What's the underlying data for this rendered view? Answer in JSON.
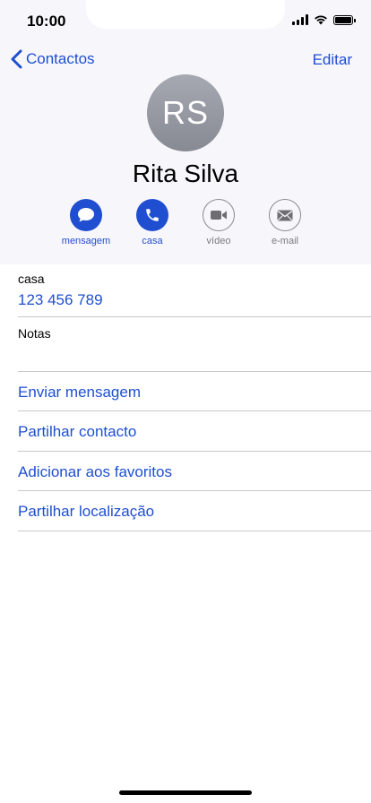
{
  "status_bar": {
    "time": "10:00"
  },
  "nav": {
    "back_label": "Contactos",
    "edit_label": "Editar"
  },
  "contact": {
    "initials": "RS",
    "name": "Rita Silva"
  },
  "actions": [
    {
      "label": "mensagem",
      "icon": "message-icon",
      "enabled": true
    },
    {
      "label": "casa",
      "icon": "phone-icon",
      "enabled": true
    },
    {
      "label": "vídeo",
      "icon": "video-icon",
      "enabled": false
    },
    {
      "label": "e-mail",
      "icon": "mail-icon",
      "enabled": false
    }
  ],
  "phone": {
    "label": "casa",
    "number": "123 456 789"
  },
  "notes": {
    "label": "Notas"
  },
  "links": [
    {
      "label": "Enviar mensagem"
    },
    {
      "label": "Partilhar contacto"
    },
    {
      "label": "Adicionar aos favoritos"
    },
    {
      "label": "Partilhar localização"
    }
  ],
  "colors": {
    "accent": "#1f4fd0",
    "header_background": "#f7f6fb",
    "avatar": "#9a9ca4",
    "inactive": "#8a8a8f"
  }
}
